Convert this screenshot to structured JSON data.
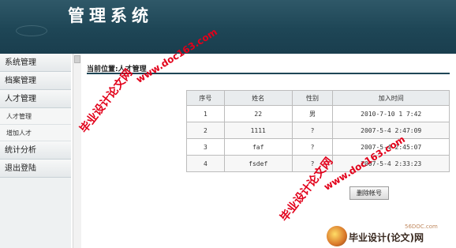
{
  "header": {
    "title": "管理系统"
  },
  "sidebar": {
    "items": [
      {
        "label": "系统管理"
      },
      {
        "label": "档案管理"
      },
      {
        "label": "人才管理"
      },
      {
        "label": "人才管理"
      },
      {
        "label": "增加人才"
      },
      {
        "label": "统计分析"
      },
      {
        "label": "退出登陆"
      }
    ]
  },
  "main": {
    "breadcrumb_label": "当前位置:",
    "breadcrumb_value": "人才管理",
    "table": {
      "headers": [
        "序号",
        "姓名",
        "性别",
        "加入时间"
      ],
      "rows": [
        {
          "no": "1",
          "name": "22",
          "gender": "男",
          "joined": "2010-7-10 1 7:42"
        },
        {
          "no": "2",
          "name": "1111",
          "gender": "?",
          "joined": "2007-5-4 2:47:09"
        },
        {
          "no": "3",
          "name": "faf",
          "gender": "?",
          "joined": "2007-5-4 2:45:07"
        },
        {
          "no": "4",
          "name": "fsdef",
          "gender": "?",
          "joined": "2007-5-4 2:33:23"
        }
      ]
    },
    "delete_button": "删除帐号"
  },
  "watermarks": {
    "url": "www.doc163.com",
    "cn": "毕业设计论文网"
  },
  "footer": {
    "site": "56DOC.com",
    "logo": "毕业设计(论文)网"
  },
  "colors": {
    "header_bg": "#1e4656",
    "watermark": "#e2001a"
  }
}
